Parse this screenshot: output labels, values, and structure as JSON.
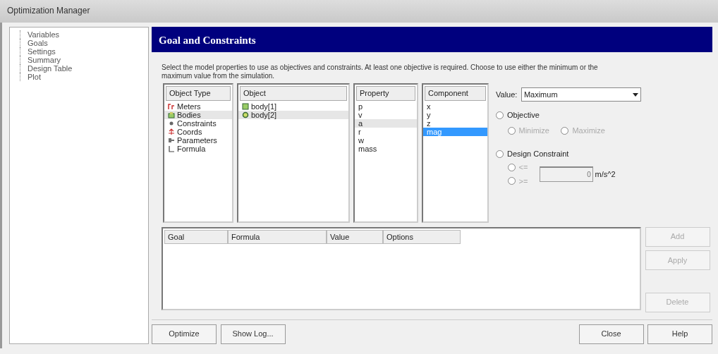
{
  "window": {
    "title": "Optimization Manager"
  },
  "sidebar": {
    "items": [
      {
        "label": "Variables"
      },
      {
        "label": "Goals"
      },
      {
        "label": "Settings"
      },
      {
        "label": "Summary"
      },
      {
        "label": "Design Table"
      },
      {
        "label": "Plot"
      }
    ]
  },
  "header": {
    "title": "Goal and Constraints"
  },
  "description": "Select the model properties to use as objectives and constraints. At least one objective is required. Choose to use either the minimum or the maximum value from the simulation.",
  "lists": [
    {
      "heading": "Object Type",
      "items": [
        {
          "label": "Meters",
          "kind": "meter",
          "selected": false
        },
        {
          "label": "Bodies",
          "kind": "body",
          "selected": true
        },
        {
          "label": "Constraints",
          "kind": "constraint",
          "selected": false
        },
        {
          "label": "Coords",
          "kind": "coord",
          "selected": false
        },
        {
          "label": "Parameters",
          "kind": "parameter",
          "selected": false
        },
        {
          "label": "Formula",
          "kind": "formula",
          "selected": false
        }
      ]
    },
    {
      "heading": "Object",
      "items": [
        {
          "label": "body[1]",
          "kind": "block",
          "selected": false
        },
        {
          "label": "body[2]",
          "kind": "ball",
          "selected": true
        }
      ]
    },
    {
      "heading": "Property",
      "items": [
        {
          "label": "p",
          "selected": false
        },
        {
          "label": "v",
          "selected": false
        },
        {
          "label": "a",
          "selected": true
        },
        {
          "label": "r",
          "selected": false
        },
        {
          "label": "w",
          "selected": false
        },
        {
          "label": "mass",
          "selected": false
        }
      ]
    },
    {
      "heading": "Component",
      "items": [
        {
          "label": "x",
          "selected": false
        },
        {
          "label": "y",
          "selected": false
        },
        {
          "label": "z",
          "selected": false
        },
        {
          "label": "mag",
          "selected": true
        }
      ]
    }
  ],
  "value": {
    "label": "Value:",
    "selected": "Maximum"
  },
  "objective": {
    "label": "Objective",
    "selected": false,
    "options": [
      {
        "label": "Minimize",
        "selected": false,
        "disabled": true
      },
      {
        "label": "Maximize",
        "selected": false,
        "disabled": true
      }
    ]
  },
  "design_constraint": {
    "label": "Design Constraint",
    "selected": false,
    "options": [
      {
        "label": "<=",
        "selected": false,
        "disabled": true
      },
      {
        "label": ">=",
        "selected": false,
        "disabled": true
      }
    ],
    "limit": "0",
    "unit": "m/s^2"
  },
  "goals_table": {
    "columns": [
      "Goal",
      "Formula",
      "Value",
      "Options"
    ]
  },
  "side_buttons": [
    {
      "label": "Add",
      "disabled": true
    },
    {
      "label": "Apply",
      "disabled": true
    },
    {
      "label": "Delete",
      "disabled": true
    }
  ],
  "bottom_buttons": {
    "left": [
      {
        "label": "Optimize"
      },
      {
        "label": "Show Log..."
      }
    ],
    "right": [
      {
        "label": "Close"
      },
      {
        "label": "Help"
      }
    ]
  }
}
